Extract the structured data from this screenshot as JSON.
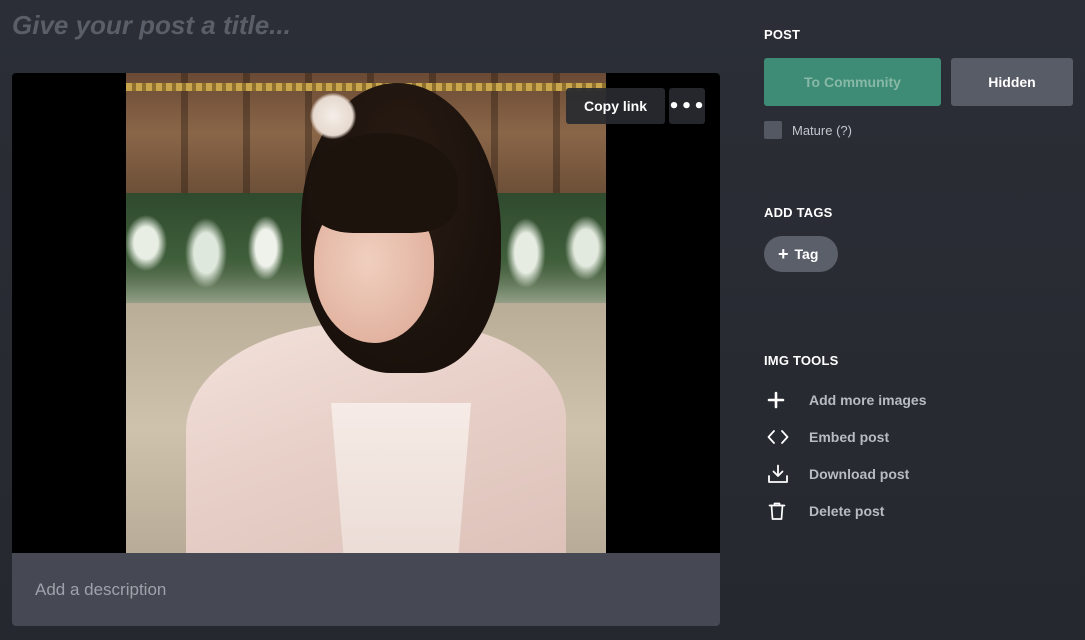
{
  "editor": {
    "title_placeholder": "Give your post a title...",
    "description_placeholder": "Add a description",
    "copy_link_label": "Copy link",
    "more_label": "•••"
  },
  "panel": {
    "post": {
      "heading": "POST",
      "to_community_label": "To Community",
      "hidden_label": "Hidden",
      "mature_label": "Mature (?)"
    },
    "tags": {
      "heading": "ADD TAGS",
      "tag_label": "Tag",
      "tag_plus": "+"
    },
    "img_tools": {
      "heading": "IMG TOOLS",
      "items": [
        {
          "label": "Add more images",
          "icon": "plus-icon"
        },
        {
          "label": "Embed post",
          "icon": "code-brackets-icon"
        },
        {
          "label": "Download post",
          "icon": "download-icon"
        },
        {
          "label": "Delete post",
          "icon": "trash-icon"
        }
      ]
    }
  },
  "colors": {
    "background": "#2b2e36",
    "community_button": "#3e8c75",
    "hidden_button": "#585c67",
    "description_bg": "#464953",
    "tag_button": "#5b5f6a"
  }
}
